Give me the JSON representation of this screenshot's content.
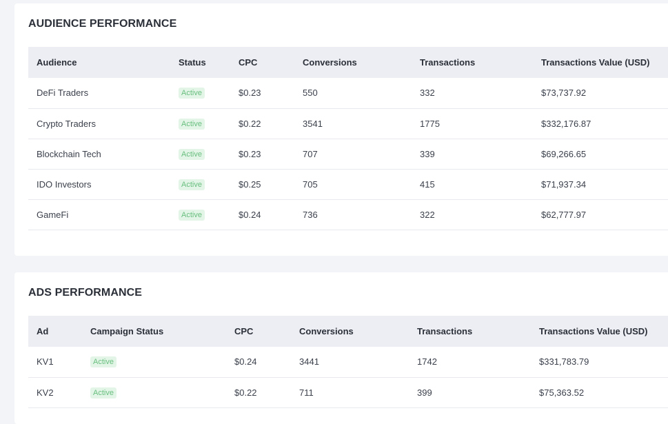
{
  "audience": {
    "title": "AUDIENCE PERFORMANCE",
    "columns": [
      "Audience",
      "Status",
      "CPC",
      "Conversions",
      "Transactions",
      "Transactions Value (USD)"
    ],
    "rows": [
      {
        "name": "DeFi Traders",
        "status": "Active",
        "cpc": "$0.23",
        "conversions": "550",
        "transactions": "332",
        "value": "$73,737.92"
      },
      {
        "name": "Crypto Traders",
        "status": "Active",
        "cpc": "$0.22",
        "conversions": "3541",
        "transactions": "1775",
        "value": "$332,176.87"
      },
      {
        "name": "Blockchain Tech",
        "status": "Active",
        "cpc": "$0.23",
        "conversions": "707",
        "transactions": "339",
        "value": "$69,266.65"
      },
      {
        "name": "IDO Investors",
        "status": "Active",
        "cpc": "$0.25",
        "conversions": "705",
        "transactions": "415",
        "value": "$71,937.34"
      },
      {
        "name": "GameFi",
        "status": "Active",
        "cpc": "$0.24",
        "conversions": "736",
        "transactions": "322",
        "value": "$62,777.97"
      }
    ]
  },
  "ads": {
    "title": "ADS PERFORMANCE",
    "columns": [
      "Ad",
      "Campaign Status",
      "CPC",
      "Conversions",
      "Transactions",
      "Transactions Value (USD)"
    ],
    "rows": [
      {
        "name": "KV1",
        "status": "Active",
        "cpc": "$0.24",
        "conversions": "3441",
        "transactions": "1742",
        "value": "$331,783.79"
      },
      {
        "name": "KV2",
        "status": "Active",
        "cpc": "$0.22",
        "conversions": "711",
        "transactions": "399",
        "value": "$75,363.52"
      }
    ]
  },
  "colors": {
    "page_background": "#f3f4f7",
    "card_background": "#ffffff",
    "header_row_background": "#eceef3",
    "badge_background": "#e3f5e7",
    "badge_text": "#69bf7f"
  }
}
